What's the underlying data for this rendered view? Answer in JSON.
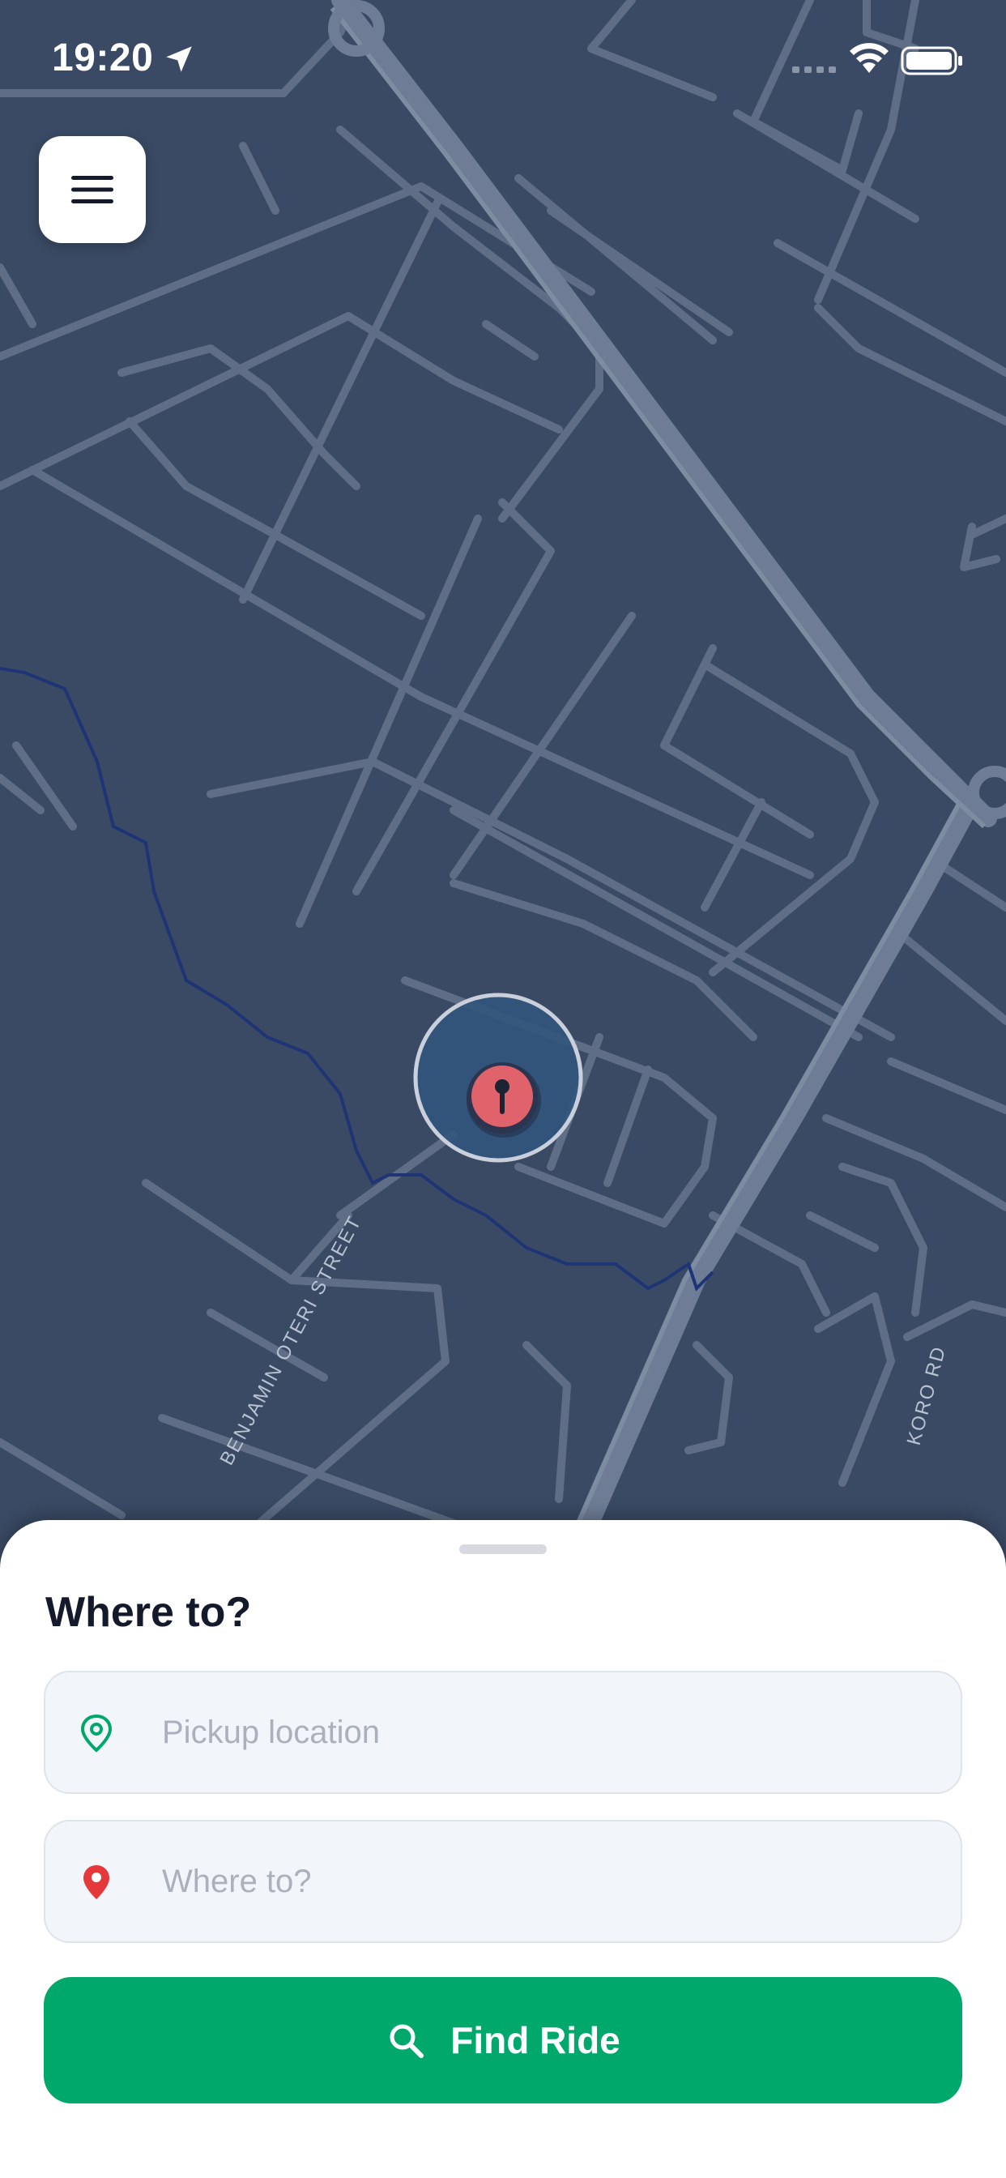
{
  "status_bar": {
    "time": "19:20"
  },
  "map": {
    "street_labels": [
      "BENJAMIN OTERI STREET",
      "KORO RD"
    ]
  },
  "menu": {
    "icon": "hamburger-menu-icon"
  },
  "sheet": {
    "title": "Where to?",
    "pickup": {
      "placeholder": "Pickup location",
      "value": "",
      "icon": "pickup-pin-icon",
      "icon_color": "#00a86b"
    },
    "destination": {
      "placeholder": "Where to?",
      "value": "",
      "icon": "destination-pin-icon",
      "icon_color": "#e5383b"
    },
    "button": {
      "label": "Find Ride",
      "icon": "search-icon",
      "color": "#00a86b"
    }
  },
  "colors": {
    "map_background": "#3a4a64",
    "road": "#6b7a92",
    "marker": "#e0626a"
  }
}
